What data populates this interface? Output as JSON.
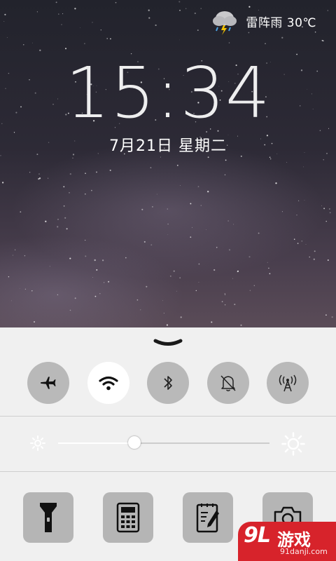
{
  "status": {
    "weather_icon": "thunderstorm-cloud-icon",
    "weather_text": "雷阵雨 30℃"
  },
  "lockscreen": {
    "time": "15:34",
    "date": "7月21日 星期二"
  },
  "control_center": {
    "grabber_icon": "chevron-down-icon",
    "toggles": [
      {
        "name": "airplane-mode",
        "icon": "airplane-icon",
        "on": false
      },
      {
        "name": "wifi",
        "icon": "wifi-icon",
        "on": true
      },
      {
        "name": "bluetooth",
        "icon": "bluetooth-icon",
        "on": false
      },
      {
        "name": "silent-mode",
        "icon": "bell-off-icon",
        "on": false
      },
      {
        "name": "hotspot",
        "icon": "antenna-icon",
        "on": false
      }
    ],
    "brightness": {
      "level": 0.36
    },
    "apps": [
      {
        "name": "flashlight",
        "icon": "flashlight-icon"
      },
      {
        "name": "calculator",
        "icon": "calculator-icon"
      },
      {
        "name": "notes",
        "icon": "notepad-icon"
      },
      {
        "name": "camera",
        "icon": "camera-icon"
      }
    ]
  },
  "watermark": {
    "logo": "9L",
    "name": "游戏",
    "url": "91danji.com"
  },
  "colors": {
    "panel_bg": "#f0f0f0",
    "toggle_off": "#b9b9b9",
    "toggle_on": "#ffffff",
    "app_tile": "#b5b5b5",
    "watermark_bg": "#d7232b"
  }
}
